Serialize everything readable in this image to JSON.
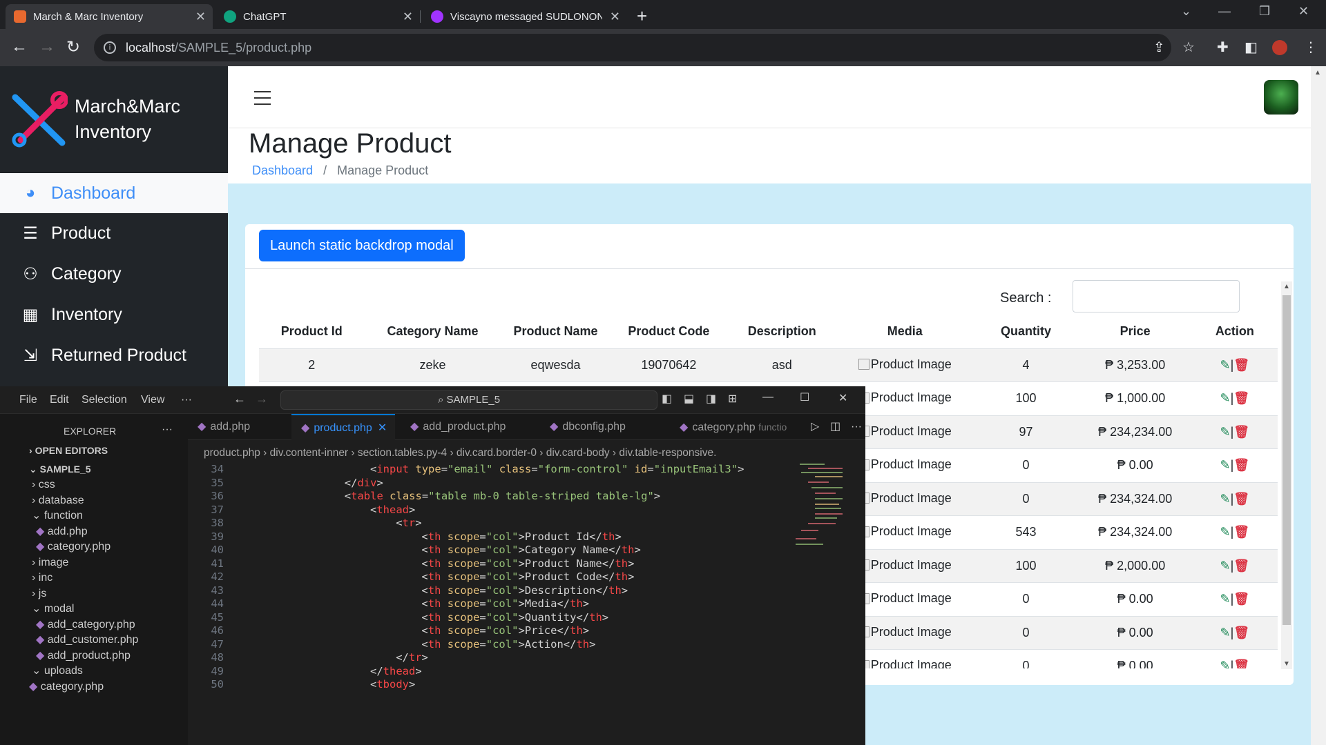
{
  "browser": {
    "tabs": [
      {
        "title": "March & Marc Inventory",
        "active": true,
        "favicon_color": "#e8692f"
      },
      {
        "title": "ChatGPT",
        "active": false,
        "favicon_color": "#10a37f"
      },
      {
        "title": "Viscayno messaged SUDLONON",
        "active": false,
        "favicon_color": "#a033ff"
      }
    ],
    "url_host": "localhost",
    "url_path": "/SAMPLE_5/product.php"
  },
  "sidebar": {
    "brand_line1": "March&Marc",
    "brand_line2": "Inventory",
    "items": [
      {
        "label": "Dashboard",
        "icon": "dashboard-gauge-icon",
        "active": true
      },
      {
        "label": "Product",
        "icon": "sliders-icon"
      },
      {
        "label": "Category",
        "icon": "user-icon"
      },
      {
        "label": "Inventory",
        "icon": "boxes-icon"
      },
      {
        "label": "Returned Product",
        "icon": "return-hand-icon"
      }
    ]
  },
  "page": {
    "title": "Manage Product",
    "breadcrumb_home": "Dashboard",
    "breadcrumb_sep": "/",
    "breadcrumb_current": "Manage Product",
    "launch_button": "Launch static backdrop modal",
    "search_label": "Search :"
  },
  "table": {
    "columns": [
      "Product Id",
      "Category Name",
      "Product Name",
      "Product Code",
      "Description",
      "Media",
      "Quantity",
      "Price",
      "Action"
    ],
    "first_row": {
      "id": "2",
      "category": "zeke",
      "name": "eqwesda",
      "code": "19070642",
      "description": "asd"
    },
    "media_alt": "Product Image",
    "rows": [
      {
        "quantity": "4",
        "price": "₱ 3,253.00"
      },
      {
        "quantity": "100",
        "price": "₱ 1,000.00"
      },
      {
        "quantity": "97",
        "price": "₱ 234,234.00"
      },
      {
        "quantity": "0",
        "price": "₱ 0.00"
      },
      {
        "quantity": "0",
        "price": "₱ 234,324.00"
      },
      {
        "quantity": "543",
        "price": "₱ 234,324.00"
      },
      {
        "quantity": "100",
        "price": "₱ 2,000.00"
      },
      {
        "quantity": "0",
        "price": "₱ 0.00"
      },
      {
        "quantity": "0",
        "price": "₱ 0.00"
      },
      {
        "quantity": "0",
        "price": "₱ 0.00"
      }
    ],
    "action_sep": "|",
    "colors": {
      "edit": "#198754",
      "delete": "#dc3545"
    }
  },
  "vscode": {
    "menus": [
      "File",
      "Edit",
      "Selection",
      "View",
      "···"
    ],
    "command_center": "SAMPLE_5",
    "explorer_title": "EXPLORER",
    "open_editors": "OPEN EDITORS",
    "project": "SAMPLE_5",
    "tree": [
      {
        "label": "css",
        "type": "folder"
      },
      {
        "label": "database",
        "type": "folder"
      },
      {
        "label": "function",
        "type": "folder-open"
      },
      {
        "label": "add.php",
        "type": "file"
      },
      {
        "label": "category.php",
        "type": "file"
      },
      {
        "label": "image",
        "type": "folder"
      },
      {
        "label": "inc",
        "type": "folder"
      },
      {
        "label": "js",
        "type": "folder"
      },
      {
        "label": "modal",
        "type": "folder-open"
      },
      {
        "label": "add_category.php",
        "type": "file"
      },
      {
        "label": "add_customer.php",
        "type": "file"
      },
      {
        "label": "add_product.php",
        "type": "file"
      },
      {
        "label": "uploads",
        "type": "folder-open"
      },
      {
        "label": "category.php",
        "type": "file"
      }
    ],
    "tabs": [
      "add.php",
      "product.php",
      "add_product.php",
      "dbconfig.php",
      "category.php"
    ],
    "tab_hint": "functio",
    "breadcrumb": [
      "product.php",
      "div.content-inner",
      "section.tables.py-4",
      "div.card.border-0",
      "div.card-body",
      "div.table-responsive."
    ],
    "line_numbers": [
      "34",
      "35",
      "36",
      "37",
      "38",
      "39",
      "40",
      "41",
      "42",
      "43",
      "44",
      "45",
      "46",
      "47",
      "48",
      "49",
      "50"
    ],
    "code": {
      "l34": {
        "attr1": "type",
        "val1": "\"email\"",
        "attr2": "class",
        "val2": "\"form-control\"",
        "attr3": "id",
        "val3": "\"inputEmail3\""
      },
      "l36": {
        "attr": "class",
        "val": "\"table mb-0 table-striped table-lg\""
      },
      "th_labels": [
        "Product Id",
        "Category Name",
        "Product Name",
        "Product Code",
        "Description",
        "Media",
        "Quantity",
        "Price",
        "Action"
      ]
    }
  }
}
